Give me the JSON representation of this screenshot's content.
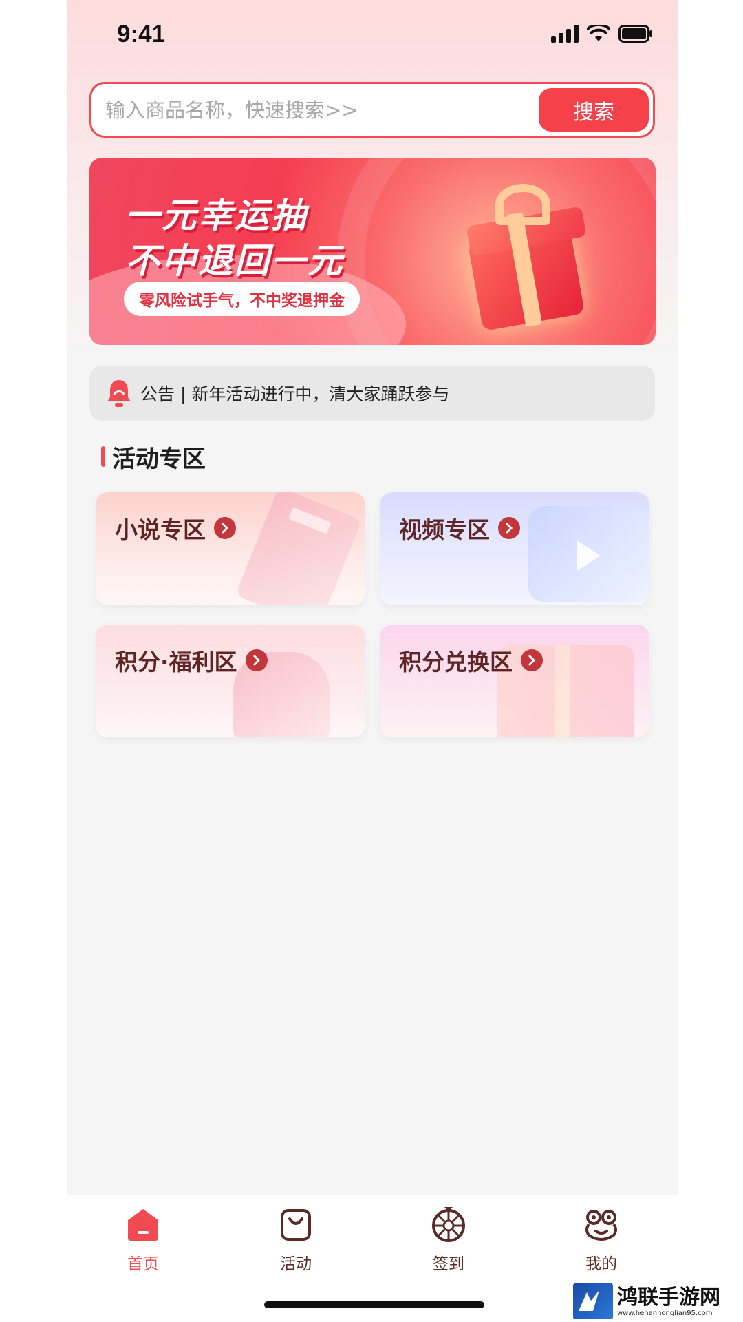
{
  "status_bar": {
    "time": "9:41"
  },
  "search": {
    "placeholder": "输入商品名称，快速搜索>>",
    "button_label": "搜索"
  },
  "banner": {
    "title_line1": "一元幸运抽",
    "title_line2": "不中退回一元",
    "tag": "零风险试手气，不中奖退押金"
  },
  "notice": {
    "text": "公告 | 新年活动进行中，清大家踊跃参与"
  },
  "section": {
    "title": "活动专区"
  },
  "cards": [
    {
      "label": "小说专区"
    },
    {
      "label": "视频专区"
    },
    {
      "label": "积分·福利区"
    },
    {
      "label": "积分兑换区"
    }
  ],
  "tabs": [
    {
      "label": "首页",
      "icon": "home-icon",
      "active": true
    },
    {
      "label": "活动",
      "icon": "bag-icon",
      "active": false
    },
    {
      "label": "签到",
      "icon": "wheel-icon",
      "active": false
    },
    {
      "label": "我的",
      "icon": "frog-icon",
      "active": false
    }
  ],
  "watermark": {
    "title": "鸿联手游网",
    "url": "www.henanhonglian95.com"
  },
  "colors": {
    "accent": "#f24a52",
    "card_text": "#5e2524",
    "arrow": "#c2373c"
  }
}
